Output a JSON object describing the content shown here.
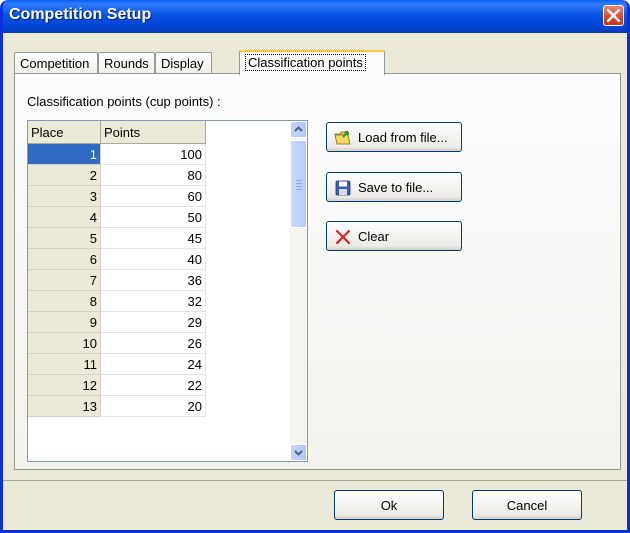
{
  "window": {
    "title": "Competition Setup"
  },
  "tabs": [
    {
      "label": "Competition"
    },
    {
      "label": "Rounds"
    },
    {
      "label": "Display"
    },
    {
      "label": "Classification points"
    }
  ],
  "panel": {
    "label": "Classification points (cup points) :"
  },
  "grid": {
    "columns": [
      "Place",
      "Points"
    ],
    "rows": [
      [
        "1",
        "100"
      ],
      [
        "2",
        "80"
      ],
      [
        "3",
        "60"
      ],
      [
        "4",
        "50"
      ],
      [
        "5",
        "45"
      ],
      [
        "6",
        "40"
      ],
      [
        "7",
        "36"
      ],
      [
        "8",
        "32"
      ],
      [
        "9",
        "29"
      ],
      [
        "10",
        "26"
      ],
      [
        "11",
        "24"
      ],
      [
        "12",
        "22"
      ],
      [
        "13",
        "20"
      ]
    ]
  },
  "actions": {
    "load_label": "Load from file...",
    "save_label": "Save to file...",
    "clear_label": "Clear"
  },
  "footer": {
    "ok_label": "Ok",
    "cancel_label": "Cancel"
  },
  "colors": {
    "titlebar": "#0653e6",
    "selection": "#316ac5",
    "button_border": "#003c74"
  }
}
